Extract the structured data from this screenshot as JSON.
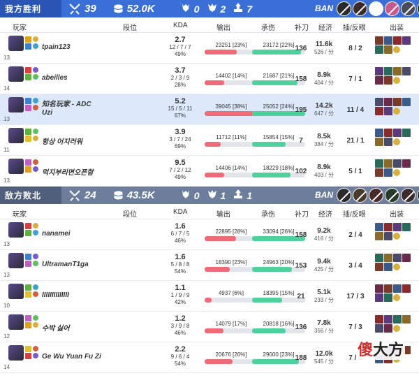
{
  "colors": {
    "win": "#3a6fd8",
    "lose": "#6d7e9c",
    "dmg": "#f06b78",
    "taken": "#4fd19e",
    "hl": "#dde9fb"
  },
  "headers": {
    "player": "玩家",
    "rank": "段位",
    "kda": "KDA",
    "dmg": "输出",
    "taken": "承伤",
    "cs": "补刀",
    "eco": "经济",
    "wards": "插/反眼",
    "items": "出装"
  },
  "teams": [
    {
      "name": "我方胜利",
      "kills": "39",
      "gold": "52.0K",
      "towers": "0",
      "dragons": "2",
      "barons": "7",
      "ban_label": "BAN",
      "bans": [
        "#2a2a2a",
        "#3b2a2a",
        "empty",
        "#c75a8a",
        "#4a4a5a",
        "#2e2e2e"
      ],
      "players": [
        {
          "name": "tpain123",
          "tag": "",
          "level": "13",
          "kda_ratio": "2.7",
          "kda_split": "12 / 7 / 7",
          "kp": "49%",
          "dmg": "23251 [23%]",
          "dmg_pct": 0.6,
          "taken": "23172 [22%]",
          "taken_pct": 0.92,
          "cs": "136",
          "gold": "11.6k",
          "gpm": "526 / 分",
          "wards": "8 / 2",
          "hl": false
        },
        {
          "name": "abeilles",
          "tag": "",
          "level": "14",
          "kda_ratio": "3.7",
          "kda_split": "2 / 3 / 9",
          "kp": "28%",
          "dmg": "14402 [14%]",
          "dmg_pct": 0.37,
          "taken": "21687 [21%]",
          "taken_pct": 0.86,
          "cs": "158",
          "gold": "8.9k",
          "gpm": "404 / 分",
          "wards": "7 / 1",
          "hl": false
        },
        {
          "name": "知名玩家 - ADC",
          "tag": "Uzi",
          "level": "13",
          "kda_ratio": "5.2",
          "kda_split": "15 / 5 / 11",
          "kp": "67%",
          "dmg": "39045 [38%]",
          "dmg_pct": 1.0,
          "taken": "25052 [24%]",
          "taken_pct": 1.0,
          "cs": "195",
          "gold": "14.2k",
          "gpm": "647 / 分",
          "wards": "11 / 4",
          "hl": true
        },
        {
          "name": "항상 어지러워",
          "tag": "",
          "level": "11",
          "kda_ratio": "3.9",
          "kda_split": "3 / 7 / 24",
          "kp": "69%",
          "dmg": "11712 [11%]",
          "dmg_pct": 0.3,
          "taken": "15854 [15%]",
          "taken_pct": 0.63,
          "cs": "7",
          "gold": "8.5k",
          "gpm": "384 / 分",
          "wards": "21 / 1",
          "hl": false
        },
        {
          "name": "먹지부리면오픈함",
          "tag": "",
          "level": "13",
          "kda_ratio": "9.5",
          "kda_split": "7 / 2 / 12",
          "kp": "49%",
          "dmg": "14406 [14%]",
          "dmg_pct": 0.37,
          "taken": "18229 [18%]",
          "taken_pct": 0.73,
          "cs": "102",
          "gold": "8.9k",
          "gpm": "403 / 分",
          "wards": "5 / 1",
          "hl": false
        }
      ]
    },
    {
      "name": "敌方败北",
      "kills": "24",
      "gold": "43.5K",
      "towers": "0",
      "dragons": "1",
      "barons": "1",
      "ban_label": "BAN",
      "bans": [
        "#2a2a2a",
        "#4a3a2a",
        "#4a2a2a",
        "#2a3a2a",
        "#3a2a2a",
        "#2a2a3a"
      ],
      "players": [
        {
          "name": "nanamei",
          "tag": "",
          "level": "13",
          "kda_ratio": "1.6",
          "kda_split": "6 / 7 / 5",
          "kp": "46%",
          "dmg": "22895 [28%]",
          "dmg_pct": 0.59,
          "taken": "33094 [26%]",
          "taken_pct": 1.0,
          "cs": "158",
          "gold": "9.2k",
          "gpm": "416 / 分",
          "wards": "2 / 4",
          "hl": false
        },
        {
          "name": "UltramanT1ga",
          "tag": "",
          "level": "13",
          "kda_ratio": "1.6",
          "kda_split": "5 / 8 / 8",
          "kp": "54%",
          "dmg": "18390 [23%]",
          "dmg_pct": 0.47,
          "taken": "24963 [20%]",
          "taken_pct": 0.75,
          "cs": "153",
          "gold": "9.4k",
          "gpm": "425 / 分",
          "wards": "3 / 4",
          "hl": false
        },
        {
          "name": "IIIIIIIIIIIIII",
          "tag": "",
          "level": "10",
          "kda_ratio": "1.1",
          "kda_split": "1 / 9 / 9",
          "kp": "42%",
          "dmg": "4937 [6%]",
          "dmg_pct": 0.13,
          "taken": "18395 [15%]",
          "taken_pct": 0.56,
          "cs": "21",
          "gold": "5.1k",
          "gpm": "233 / 分",
          "wards": "17 / 3",
          "hl": false
        },
        {
          "name": "수박 싫어",
          "tag": "",
          "level": "12",
          "kda_ratio": "1.2",
          "kda_split": "3 / 9 / 8",
          "kp": "46%",
          "dmg": "14079 [17%]",
          "dmg_pct": 0.36,
          "taken": "20818 [16%]",
          "taken_pct": 0.63,
          "cs": "136",
          "gold": "7.8k",
          "gpm": "356 / 分",
          "wards": "7 / 3",
          "hl": false
        },
        {
          "name": "Ge Wu Yuan Fu Zi",
          "tag": "",
          "level": "14",
          "kda_ratio": "2.2",
          "kda_split": "9 / 6 / 4",
          "kp": "54%",
          "dmg": "20676 [26%]",
          "dmg_pct": 0.53,
          "taken": "29000 [23%]",
          "taken_pct": 0.88,
          "cs": "188",
          "gold": "12.0k",
          "gpm": "545 / 分",
          "wards": "7 / 1",
          "hl": false
        }
      ]
    }
  ],
  "watermark": {
    "a": "傻",
    "b": "大方"
  }
}
